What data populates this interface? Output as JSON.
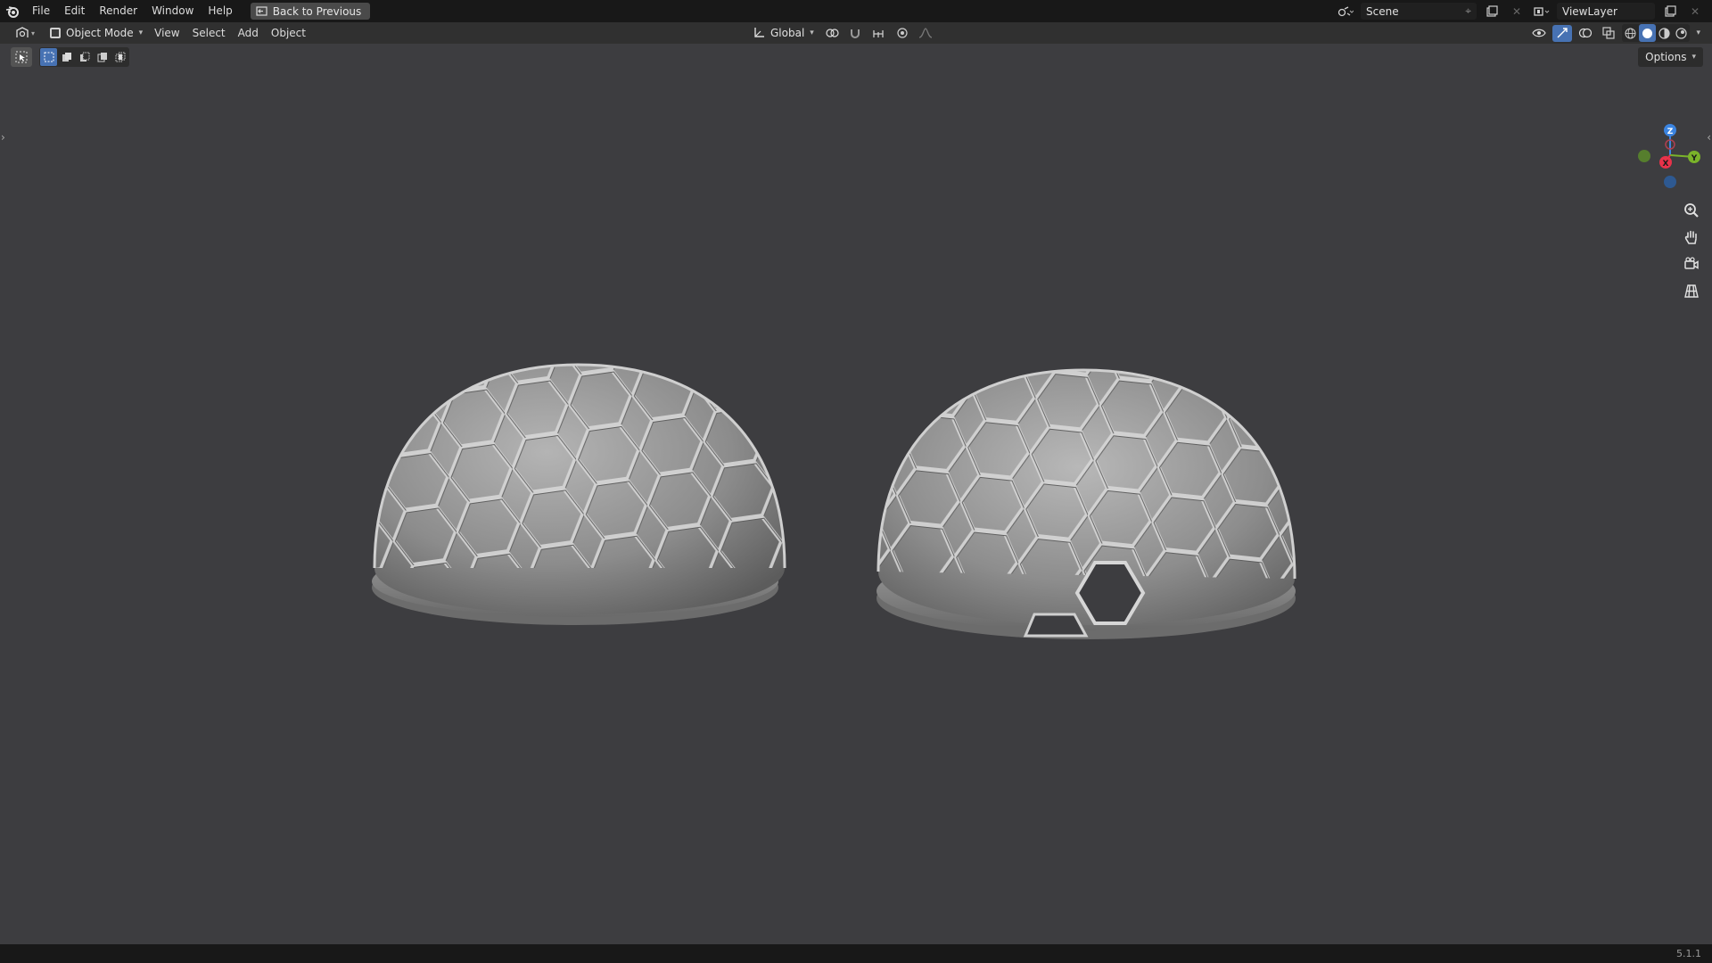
{
  "topbar": {
    "menus": [
      "File",
      "Edit",
      "Render",
      "Window",
      "Help"
    ],
    "back_button": "Back to Previous",
    "scene_name": "Scene",
    "view_layer": "ViewLayer"
  },
  "viewport_header": {
    "mode": "Object Mode",
    "menus": [
      "View",
      "Select",
      "Add",
      "Object"
    ],
    "transform_orientation": "Global",
    "options_label": "Options"
  },
  "gizmo": {
    "z_label": "Z",
    "x_label": "X",
    "y_label": "Y",
    "colors": {
      "x": "#e8324a",
      "y": "#7ab32a",
      "z": "#3b84e0"
    }
  },
  "icons": {
    "zoom": "zoom-icon",
    "pan": "hand-icon",
    "camera": "camera-view-icon",
    "ortho": "orthographic-grid-icon"
  },
  "statusbar": {
    "version": "5.1.1"
  },
  "colors": {
    "background": "#3d3d40",
    "accent": "#4772b3",
    "dome": "#8e8e8e"
  }
}
